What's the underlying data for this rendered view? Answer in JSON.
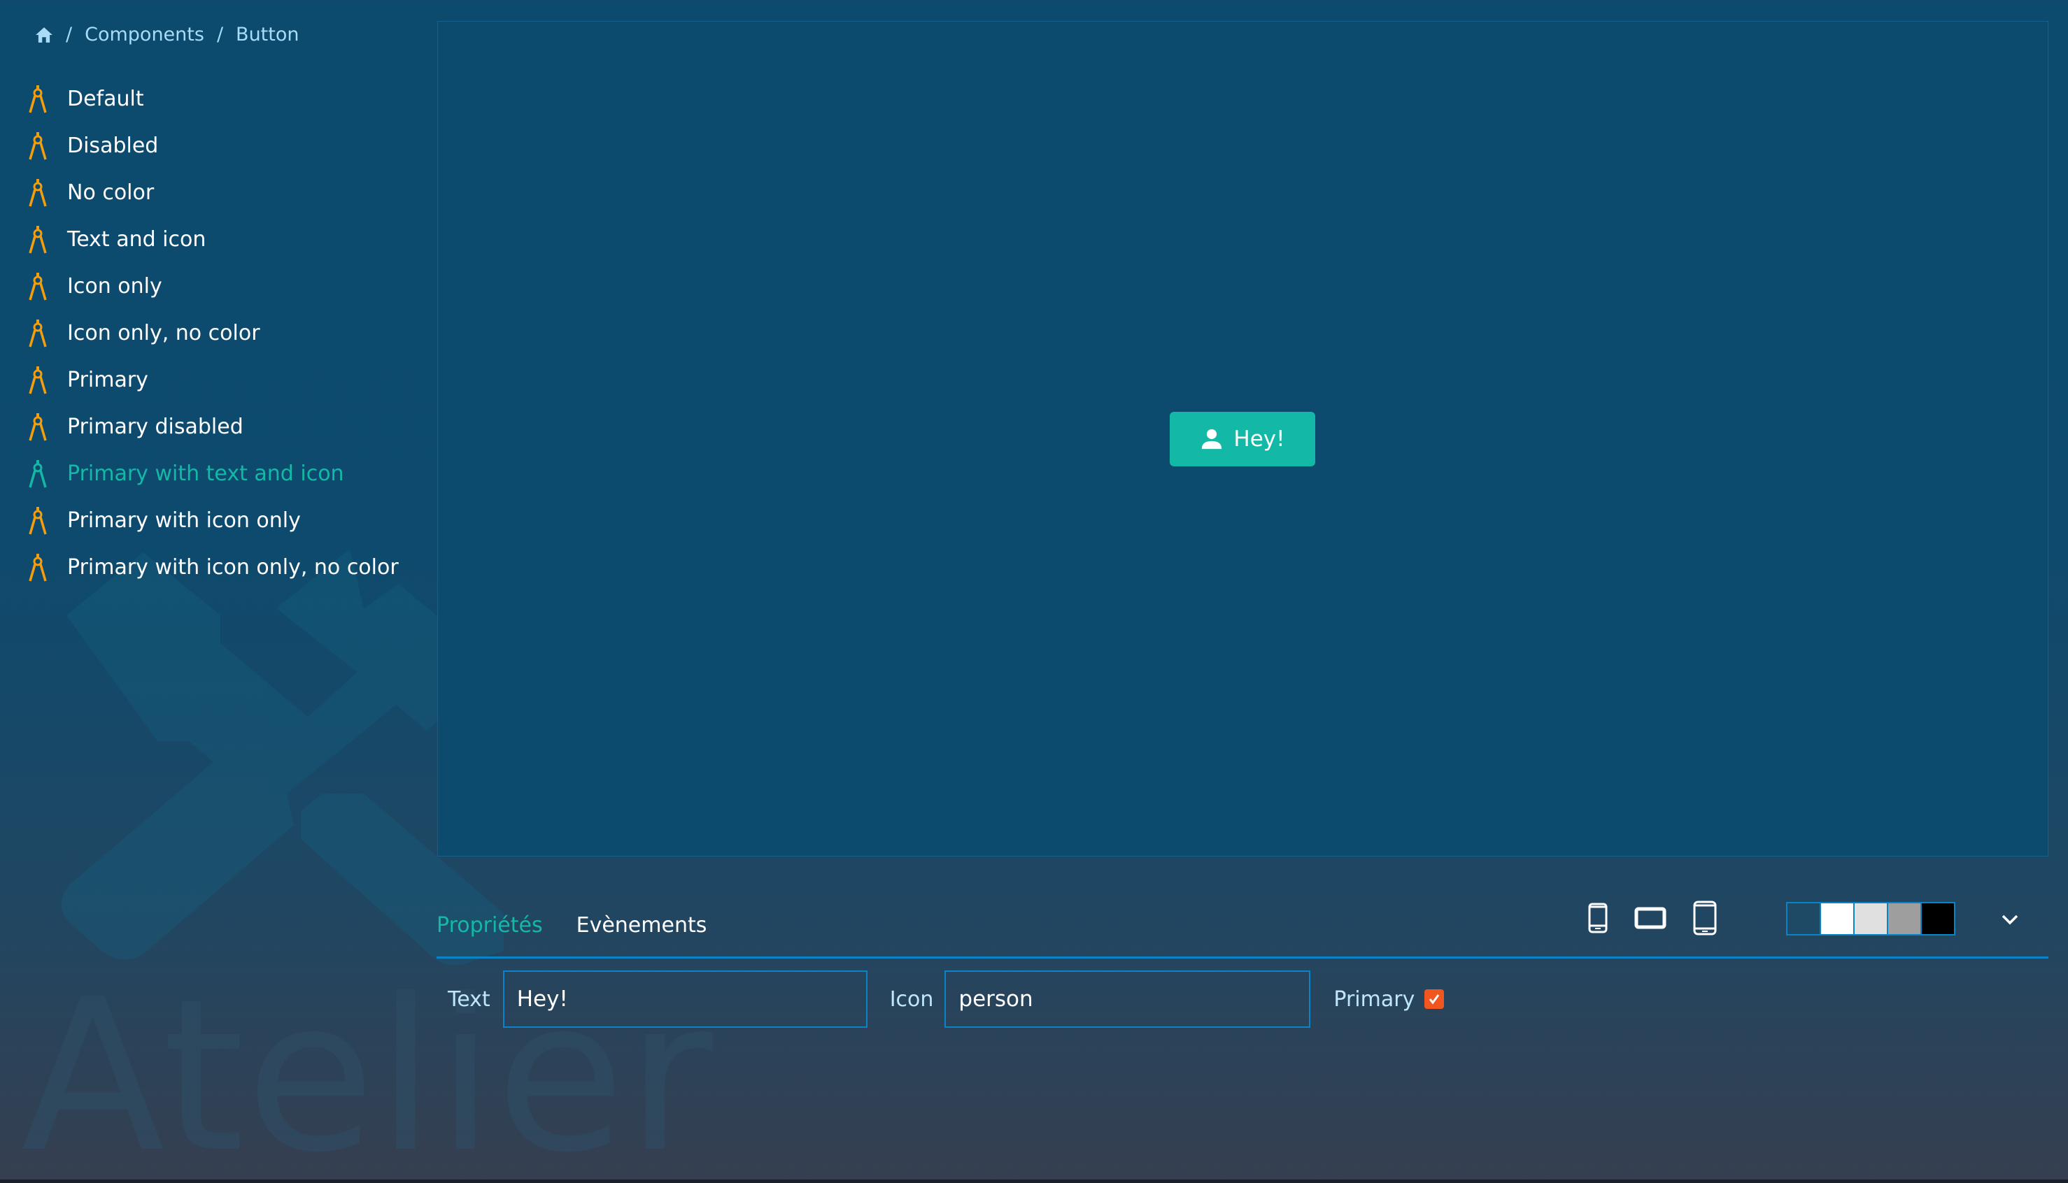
{
  "breadcrumb": {
    "home_icon": "home-icon",
    "separator": "/",
    "items": [
      "Components",
      "Button"
    ]
  },
  "sidebar": {
    "icon": "compass-icon",
    "items": [
      {
        "label": "Default"
      },
      {
        "label": "Disabled"
      },
      {
        "label": "No color"
      },
      {
        "label": "Text and icon"
      },
      {
        "label": "Icon only"
      },
      {
        "label": "Icon only, no color"
      },
      {
        "label": "Primary"
      },
      {
        "label": "Primary disabled"
      },
      {
        "label": "Primary with text and icon",
        "active": true
      },
      {
        "label": "Primary with icon only"
      },
      {
        "label": "Primary with icon only, no color"
      }
    ]
  },
  "preview": {
    "button": {
      "label": "Hey!",
      "icon": "person-icon",
      "color": "#14b8a6"
    }
  },
  "tabs": [
    {
      "label": "Propriétés",
      "active": true
    },
    {
      "label": "Evènements"
    }
  ],
  "properties": {
    "text_label": "Text",
    "text_value": "Hey!",
    "icon_label": "Icon",
    "icon_value": "person",
    "primary_label": "Primary",
    "primary_checked": true
  },
  "toolbar": {
    "devices": [
      "phone-icon",
      "tablet-landscape-icon",
      "tablet-icon"
    ],
    "backgrounds": [
      "#1e4a66",
      "#ffffff",
      "#e0e0e0",
      "#9e9e9e",
      "#000000"
    ],
    "expand_icon": "chevron-down-icon"
  },
  "watermark": {
    "text": "Atelier"
  },
  "colors": {
    "accent": "#14b8a6",
    "border": "#0a84c8",
    "icon": "#f59e0b",
    "checkbox": "#f0561d"
  }
}
